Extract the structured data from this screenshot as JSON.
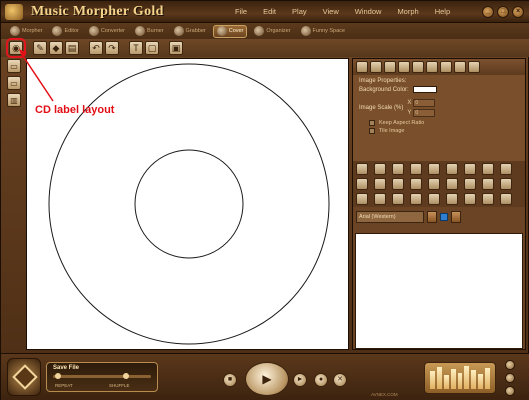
{
  "app": {
    "title": "Music Morpher Gold",
    "window_buttons": [
      "_",
      "□",
      "×"
    ]
  },
  "menu": [
    "File",
    "Edit",
    "Play",
    "View",
    "Window",
    "Morph",
    "Help"
  ],
  "modes": [
    {
      "label": "Morpher",
      "active": false
    },
    {
      "label": "Editor",
      "active": false
    },
    {
      "label": "Converter",
      "active": false
    },
    {
      "label": "Burner",
      "active": false
    },
    {
      "label": "Grabber",
      "active": false
    },
    {
      "label": "Cover",
      "active": true
    },
    {
      "label": "Organizer",
      "active": false
    },
    {
      "label": "Funny Space",
      "active": false
    }
  ],
  "annotation": {
    "label": "CD label layout",
    "color": "#e20f16"
  },
  "properties": {
    "title": "Image Properties:",
    "background_label": "Background Color:",
    "scale_label": "Image Scale (%)",
    "x_label": "X",
    "y_label": "Y",
    "x_value": "0",
    "y_value": "0",
    "keep_aspect": "Keep Aspect Ratio",
    "tile_image": "Tile Image"
  },
  "font": {
    "name": "Arial (Western)",
    "swatch_color": "#2f7fd0"
  },
  "player": {
    "file_label": "Save File",
    "repeat_label": "REPEAT",
    "shuffle_label": "SHUFFLE",
    "brand": "AVNEX.COM"
  },
  "colors": {
    "accent_red": "#e20f16",
    "panel_brown": "#6a4424",
    "gold": "#f4d38c"
  }
}
